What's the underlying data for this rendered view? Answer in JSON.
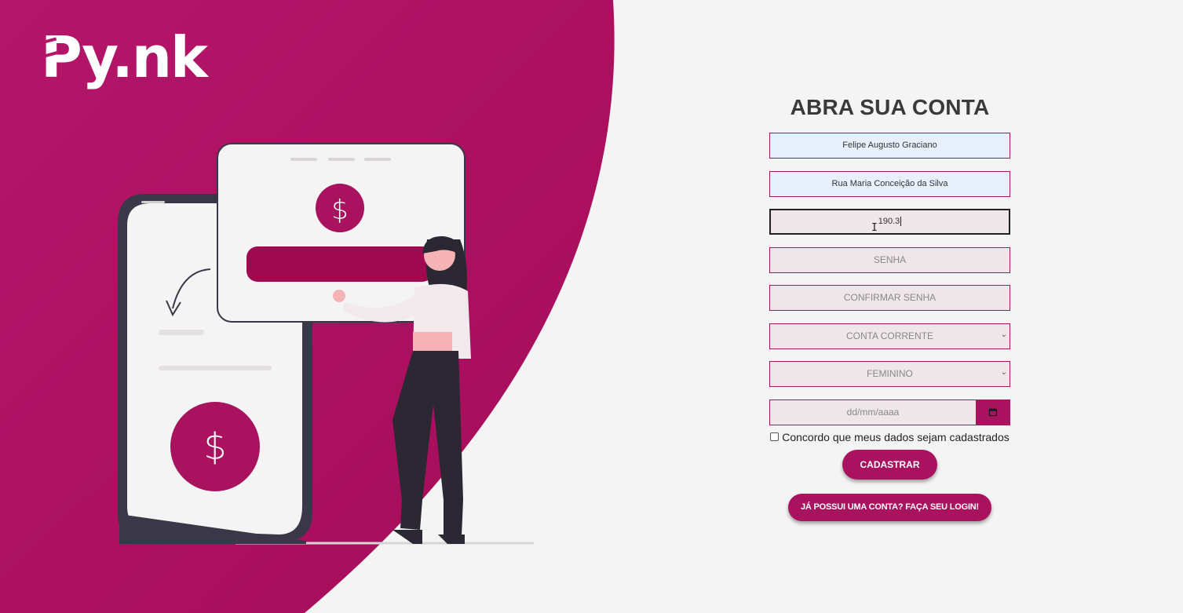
{
  "brand": {
    "logo_text": "Py.nk",
    "accent": "#a8125e"
  },
  "form": {
    "title": "ABRA SUA CONTA",
    "name_value": "Felipe Augusto Graciano",
    "address_value": "Rua Maria Conceição da Silva",
    "phone_value": "190.3",
    "password_placeholder": "SENHA",
    "confirm_placeholder": "CONFIRMAR SENHA",
    "account_type_selected": "CONTA CORRENTE",
    "gender_selected": "FEMININO",
    "date_placeholder": "dd/mm/aaaa",
    "consent_label": "Concordo que meus dados sejam cadastrados",
    "submit_label": "CADASTRAR",
    "login_label": "JÁ POSSUI UMA CONTA? FAÇA SEU LOGIN!"
  },
  "icons": {
    "calendar": "calendar-icon",
    "dropdown": "chevron-down-icon",
    "dollar": "dollar-icon"
  },
  "illustration": {
    "currency_symbol": "$"
  }
}
